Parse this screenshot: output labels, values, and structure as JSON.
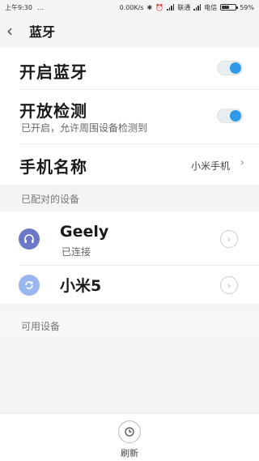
{
  "status_bar": {
    "time": "上午9:30",
    "speed": "0.00K/s",
    "carrier1": "联通",
    "carrier2": "电信",
    "battery": "59%",
    "battery_level": 0.59
  },
  "header": {
    "title": "蓝牙"
  },
  "bluetooth": {
    "label": "开启蓝牙",
    "enabled": true
  },
  "discoverable": {
    "label": "开放检测",
    "sub": "已开启，允许周围设备检测到",
    "enabled": true
  },
  "device_name": {
    "label": "手机名称",
    "value": "小米手机"
  },
  "paired": {
    "section_label": "已配对的设备",
    "devices": [
      {
        "name": "Geely",
        "status": "已连接",
        "icon": "headset-icon",
        "color": "#6b78c9"
      },
      {
        "name": "小米5",
        "status": "",
        "icon": "phone-sync-icon",
        "color": "#9ab6f0"
      }
    ]
  },
  "available": {
    "section_label": "可用设备"
  },
  "bottom": {
    "refresh_label": "刷新"
  },
  "colors": {
    "accent": "#2f9be8"
  }
}
